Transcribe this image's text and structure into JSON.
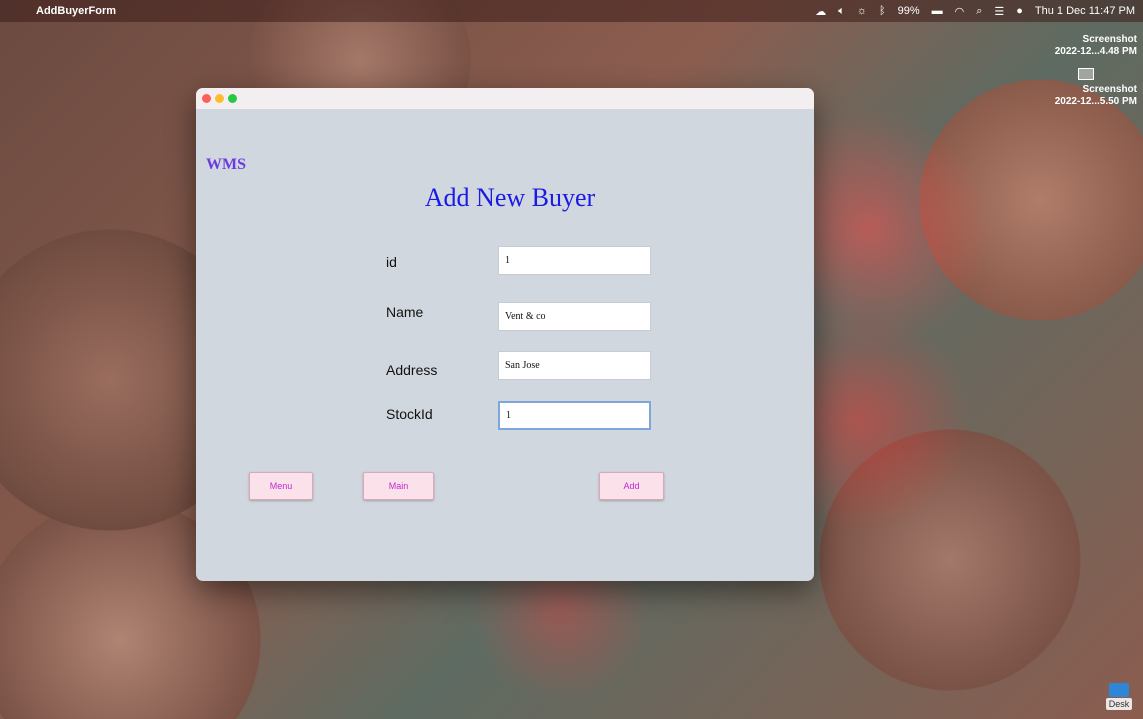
{
  "menubar": {
    "app_name": "AddBuyerForm",
    "battery": "99%",
    "datetime": "Thu 1 Dec  11:47 PM"
  },
  "desktop": {
    "screenshot1": {
      "line1": "Screenshot",
      "line2": "2022-12...4.48 PM"
    },
    "screenshot2": {
      "line1": "Screenshot",
      "line2": "2022-12...5.50 PM"
    },
    "dock_label": "Desk"
  },
  "window": {
    "brand": "WMS",
    "heading": "Add New Buyer",
    "fields": {
      "id": {
        "label": "id",
        "value": "1"
      },
      "name": {
        "label": "Name",
        "value": "Vent & co"
      },
      "address": {
        "label": "Address",
        "value": "San Jose"
      },
      "stock_id": {
        "label": "StockId",
        "value": "1"
      }
    },
    "buttons": {
      "menu": "Menu",
      "main": "Main",
      "add": "Add"
    }
  },
  "colors": {
    "window_bg": "#d1d7de",
    "heading": "#1a1ae6",
    "brand": "#6a3be0",
    "button_text": "#c02ad0",
    "button_bg": "#fbe2ea"
  }
}
